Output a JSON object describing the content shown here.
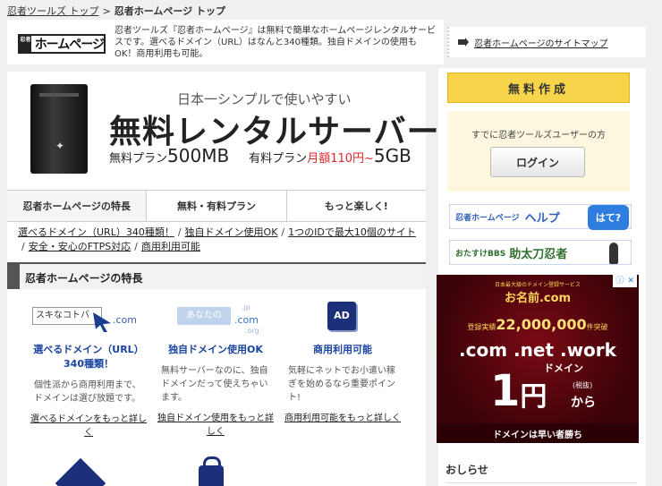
{
  "breadcrumb": {
    "top_link": "忍者ツールズ トップ",
    "sep": ">",
    "current": "忍者ホームページ トップ"
  },
  "header": {
    "logo_mark": "忍者",
    "logo_text": "ホームページ",
    "description": "忍者ツールズ『忍者ホームページ』は無料で簡単なホームページレンタルサービスです。選べるドメイン（URL）はなんと340種類。独自ドメインの使用もOK！商用利用も可能。"
  },
  "sitemap": {
    "label": "忍者ホームページのサイトマップ"
  },
  "banner": {
    "subtitle": "日本一シンプルで使いやすい",
    "title": "無料レンタルサーバー",
    "free_label": "無料プラン",
    "free_size": "500MB",
    "paid_label": "有料プラン",
    "paid_price": "月額110円~",
    "paid_size": "5GB"
  },
  "tabs": [
    "忍者ホームページの特長",
    "無料・有料プラン",
    "もっと楽しく!"
  ],
  "quick_links": [
    "選べるドメイン（URL）340種類！",
    "独自ドメイン使用OK",
    "1つのIDで最大10個のサイト",
    "安全・安心のFTPS対応",
    "商用利用可能"
  ],
  "section": {
    "title": "忍者ホームページの特長"
  },
  "features": [
    {
      "img_keyword": "スキなコトバ",
      "img_com": ".com",
      "title": "選べるドメイン（URL）340種類！",
      "desc": "個性派から商用利用まで、ドメインは選び放題です。",
      "link": "選べるドメインをもっと詳しく"
    },
    {
      "img_keyword": "あなたの",
      "img_com": ".com",
      "img_jp": ".jp",
      "img_org": ".org",
      "title": "独自ドメイン使用OK",
      "desc": "無料サーバーなのに、独自ドメインだって使えちゃいます。",
      "link": "独自ドメイン使用をもっと詳しく"
    },
    {
      "img_icon": "AD",
      "title": "商用利用可能",
      "desc": "気軽にネットでお小遣い稼ぎを始めるなら重要ポイント!",
      "link": "商用利用可能をもっと詳しく"
    }
  ],
  "sidebar": {
    "signup_label": "無料作成",
    "login_prompt": "すでに忍者ツールズユーザーの方",
    "login_button": "ログイン",
    "help_small": "忍者ホームページ",
    "help_big": "ヘルプ",
    "help_bubble": "はて?",
    "bbs_small": "おたすけBBS",
    "bbs_big": "助太刀忍者",
    "news_title": "おしらせ"
  },
  "ad": {
    "brand_tag": "日本最大級のドメイン登録サービス",
    "brand": "お名前.com",
    "reg_prefix": "登録実績",
    "reg_count": "22,000,000",
    "reg_suffix": "件突破",
    "domains": ".com .net .work",
    "domain_word": "ドメイン",
    "price": "1",
    "price_unit": "円",
    "tax": "(税抜)",
    "kara": "から",
    "footer": "ドメインは早い者勝ち"
  },
  "colors": {
    "accent_yellow": "#f8d44a",
    "link_blue": "#1a44a0",
    "ad_red": "#7a0a14",
    "price_red": "#e0262b"
  }
}
